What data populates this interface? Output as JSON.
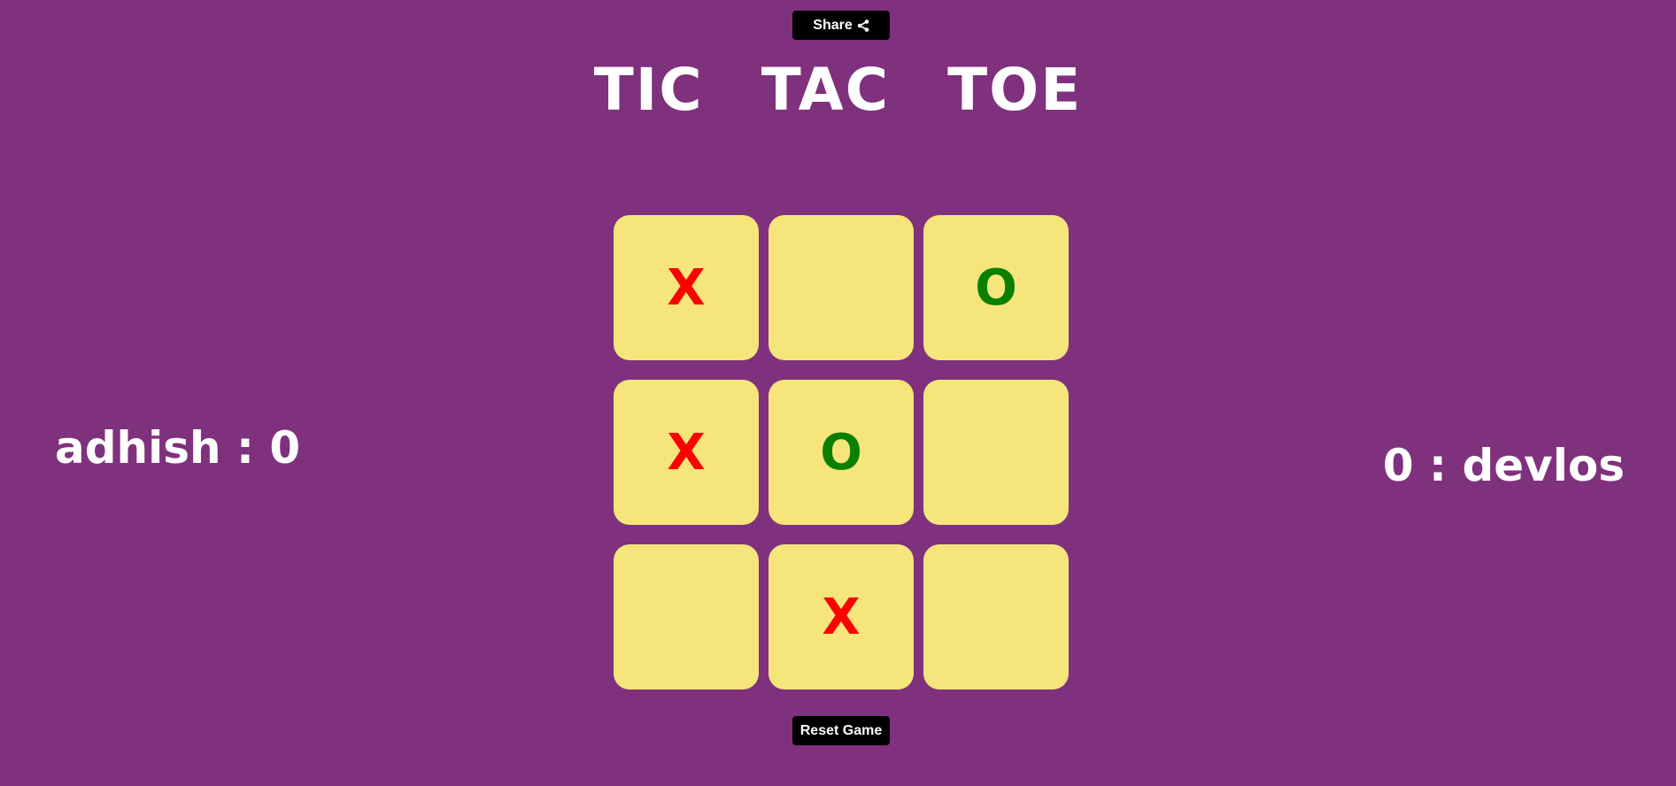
{
  "share": {
    "label": "Share",
    "icon": "share-icon"
  },
  "title": "TIC TAC TOE",
  "players": {
    "left": {
      "text": "adhish : 0"
    },
    "right": {
      "text": "0 : devlos"
    }
  },
  "board": {
    "cells": [
      "X",
      "",
      "O",
      "X",
      "O",
      "",
      "",
      "X",
      ""
    ]
  },
  "reset": {
    "label": "Reset Game"
  },
  "colors": {
    "background": "#7f317d",
    "cell": "#f5e57b",
    "x_mark": "#ff0000",
    "o_mark": "#0a8000",
    "button": "#000000"
  }
}
